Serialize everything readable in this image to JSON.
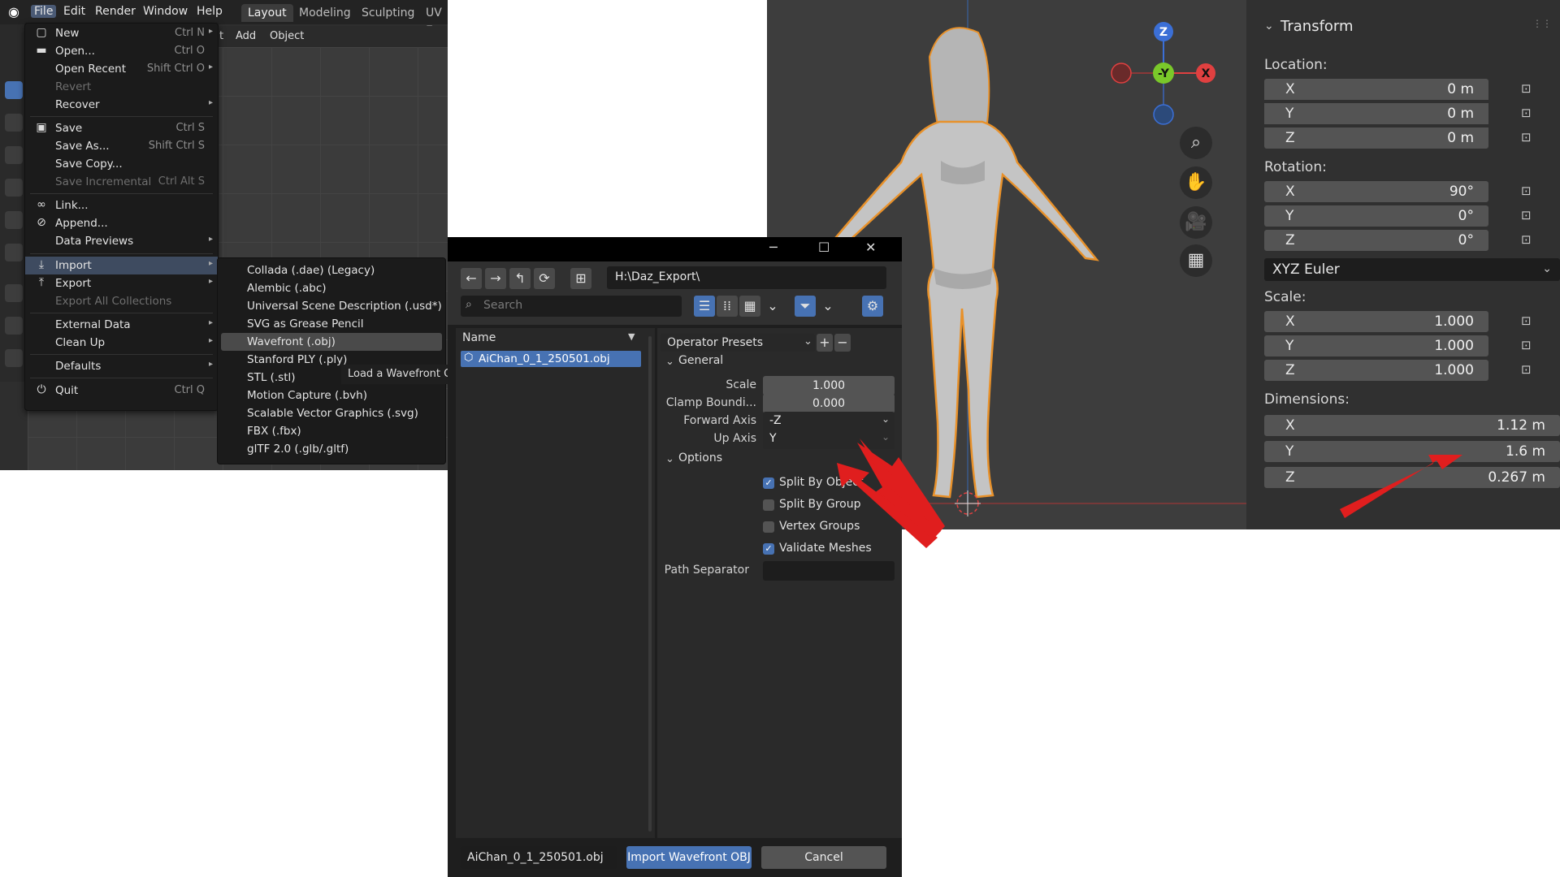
{
  "colors": {
    "accent": "#4772b3",
    "menu_bg": "#1b1b1b",
    "panel_bg": "#303030",
    "arrow": "#e01e1e",
    "outline": "#e8912a"
  },
  "menubar": {
    "items": [
      "File",
      "Edit",
      "Render",
      "Window",
      "Help"
    ]
  },
  "workspace_tabs": [
    "Layout",
    "Modeling",
    "Sculpting",
    "UV E"
  ],
  "viewport_header": {
    "items": [
      "t",
      "Add",
      "Object"
    ]
  },
  "file_menu": {
    "items": [
      {
        "label": "New",
        "shortcut": "Ctrl N",
        "icon": "new-file-icon",
        "submenu": true
      },
      {
        "label": "Open...",
        "shortcut": "Ctrl O",
        "icon": "folder-icon"
      },
      {
        "label": "Open Recent",
        "shortcut": "Shift Ctrl O",
        "submenu": true
      },
      {
        "label": "Revert",
        "disabled": true
      },
      {
        "label": "Recover",
        "submenu": true
      },
      {
        "label": "Save",
        "shortcut": "Ctrl S",
        "icon": "save-icon"
      },
      {
        "label": "Save As...",
        "shortcut": "Shift Ctrl S"
      },
      {
        "label": "Save Copy..."
      },
      {
        "label": "Save Incremental",
        "shortcut": "Ctrl Alt S",
        "disabled": true
      },
      {
        "label": "Link...",
        "icon": "link-icon"
      },
      {
        "label": "Append...",
        "icon": "append-icon"
      },
      {
        "label": "Data Previews",
        "submenu": true
      },
      {
        "label": "Import",
        "icon": "import-icon",
        "submenu": true,
        "highlighted": true
      },
      {
        "label": "Export",
        "icon": "export-icon",
        "submenu": true
      },
      {
        "label": "Export All Collections",
        "disabled": true
      },
      {
        "label": "External Data",
        "submenu": true
      },
      {
        "label": "Clean Up",
        "submenu": true
      },
      {
        "label": "Defaults",
        "submenu": true
      },
      {
        "label": "Quit",
        "shortcut": "Ctrl Q",
        "icon": "power-icon"
      }
    ]
  },
  "import_menu": {
    "items": [
      "Collada (.dae) (Legacy)",
      "Alembic (.abc)",
      "Universal Scene Description (.usd*)",
      "SVG as Grease Pencil",
      "Wavefront (.obj)",
      "Stanford PLY (.ply)",
      "STL (.stl)",
      "Motion Capture (.bvh)",
      "Scalable Vector Graphics (.svg)",
      "FBX (.fbx)",
      "glTF 2.0 (.glb/.gltf)"
    ],
    "highlighted": "Wavefront (.obj)"
  },
  "tooltip": "Load a Wavefront O",
  "gizmo": {
    "z": "Z",
    "y": "-Y",
    "x": "X"
  },
  "transform_panel": {
    "title": "Transform",
    "location": {
      "label": "Location:",
      "x": "0 m",
      "y": "0 m",
      "z": "0 m"
    },
    "rotation": {
      "label": "Rotation:",
      "x": "90°",
      "y": "0°",
      "z": "0°",
      "mode": "XYZ Euler"
    },
    "scale": {
      "label": "Scale:",
      "x": "1.000",
      "y": "1.000",
      "z": "1.000"
    },
    "dimensions": {
      "label": "Dimensions:",
      "x": "1.12 m",
      "y": "1.6 m",
      "z": "0.267 m"
    },
    "axes": {
      "x": "X",
      "y": "Y",
      "z": "Z"
    }
  },
  "dialog": {
    "path": "H:\\Daz_Export\\",
    "search_placeholder": "Search",
    "list_header": "Name",
    "files": [
      "AiChan_0_1_250501.obj"
    ],
    "operator_presets": "Operator Presets",
    "general": {
      "title": "General",
      "scale_label": "Scale",
      "scale": "1.000",
      "clamp_label": "Clamp Boundi...",
      "clamp": "0.000",
      "forward_label": "Forward Axis",
      "forward": "-Z",
      "up_label": "Up Axis",
      "up": "Y"
    },
    "options": {
      "title": "Options",
      "checks": [
        {
          "label": "Split By Object",
          "checked": true
        },
        {
          "label": "Split By Group",
          "checked": false
        },
        {
          "label": "Vertex Groups",
          "checked": false
        },
        {
          "label": "Validate Meshes",
          "checked": true
        }
      ],
      "path_sep_label": "Path Separator"
    },
    "filename": "AiChan_0_1_250501.obj",
    "import_button": "Import Wavefront OBJ",
    "cancel_button": "Cancel"
  }
}
